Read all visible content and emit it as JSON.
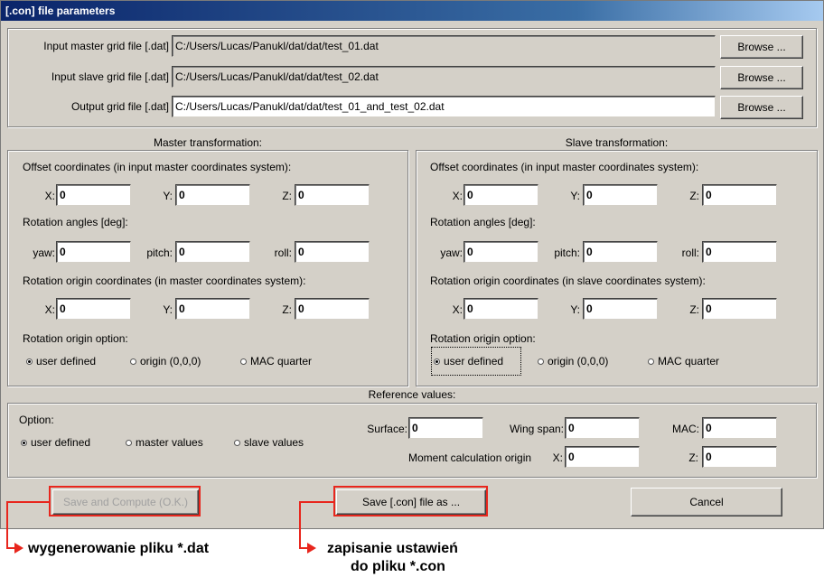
{
  "window": {
    "title": "[.con] file parameters"
  },
  "files": {
    "master_label": "Input master grid file [.dat]",
    "master_value": "C:/Users/Lucas/Panukl/dat/dat/test_01.dat",
    "slave_label": "Input slave grid file [.dat]",
    "slave_value": "C:/Users/Lucas/Panukl/dat/dat/test_02.dat",
    "output_label": "Output grid file [.dat]",
    "output_value": "C:/Users/Lucas/Panukl/dat/dat/test_01_and_test_02.dat",
    "browse_label": "Browse ..."
  },
  "master": {
    "title": "Master transformation:",
    "offset_label": "Offset coordinates (in input master coordinates system):",
    "offset": {
      "x_label": "X:",
      "x": "0",
      "y_label": "Y:",
      "y": "0",
      "z_label": "Z:",
      "z": "0"
    },
    "rotation_label": "Rotation angles [deg]:",
    "rotation": {
      "yaw_label": "yaw:",
      "yaw": "0",
      "pitch_label": "pitch:",
      "pitch": "0",
      "roll_label": "roll:",
      "roll": "0"
    },
    "origin_label": "Rotation origin coordinates (in master coordinates system):",
    "origin": {
      "x_label": "X:",
      "x": "0",
      "y_label": "Y:",
      "y": "0",
      "z_label": "Z:",
      "z": "0"
    },
    "option_label": "Rotation origin option:",
    "options": [
      "user defined",
      "origin (0,0,0)",
      "MAC quarter"
    ],
    "selected": 0
  },
  "slave": {
    "title": "Slave transformation:",
    "offset_label": "Offset coordinates (in input master coordinates system):",
    "offset": {
      "x_label": "X:",
      "x": "0",
      "y_label": "Y:",
      "y": "0",
      "z_label": "Z:",
      "z": "0"
    },
    "rotation_label": "Rotation angles [deg]:",
    "rotation": {
      "yaw_label": "yaw:",
      "yaw": "0",
      "pitch_label": "pitch:",
      "pitch": "0",
      "roll_label": "roll:",
      "roll": "0"
    },
    "origin_label": "Rotation origin coordinates (in slave coordinates system):",
    "origin": {
      "x_label": "X:",
      "x": "0",
      "y_label": "Y:",
      "y": "0",
      "z_label": "Z:",
      "z": "0"
    },
    "option_label": "Rotation origin option:",
    "options": [
      "user defined",
      "origin (0,0,0)",
      "MAC quarter"
    ],
    "selected": 0
  },
  "reference": {
    "title": "Reference values:",
    "option_label": "Option:",
    "options": [
      "user defined",
      "master values",
      "slave values"
    ],
    "selected": 0,
    "surface_label": "Surface:",
    "surface": "0",
    "wingspan_label": "Wing span:",
    "wingspan": "0",
    "mac_label": "MAC:",
    "mac": "0",
    "moment_label": "Moment calculation origin",
    "x_label": "X:",
    "x": "0",
    "z_label": "Z:",
    "z": "0"
  },
  "buttons": {
    "save_compute": "Save and Compute (O.K.)",
    "save_con": "Save [.con] file as ...",
    "cancel": "Cancel"
  },
  "annotations": {
    "left": "wygenerowanie pliku *.dat",
    "right_line1": "zapisanie ustawień",
    "right_line2": "do pliku *.con",
    "color": "#e8261d"
  }
}
